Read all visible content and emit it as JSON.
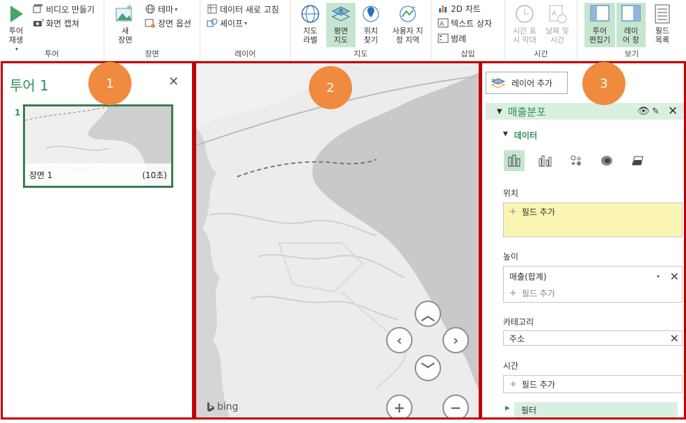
{
  "ribbon": {
    "tour": {
      "label": "투어",
      "play_label": "투어\n재생",
      "make_video": "비디오 만들기",
      "capture_screen": "화면 캡쳐"
    },
    "scene": {
      "label": "장면",
      "new_scene": "새\n장면",
      "theme": "테마",
      "scene_options": "장면 옵션"
    },
    "layer": {
      "label": "레이어",
      "refresh_data": "데이터 새로 고침",
      "shapes": "셰이프"
    },
    "map": {
      "label": "지도",
      "map_labels": "지도\n라벨",
      "flat_map": "평면\n지도",
      "find_location": "위치\n찾기",
      "custom_regions": "사용자 지\n정 지역"
    },
    "insert": {
      "label": "삽입",
      "chart_2d": "2D 차트",
      "text_box": "텍스트 상자",
      "legend": "범례"
    },
    "time": {
      "label": "시간",
      "timeline": "시간 표\n시 막대",
      "date_time": "날짜 및\n시간"
    },
    "view": {
      "label": "보기",
      "tour_editor": "투어\n편집기",
      "layer_pane": "레이\n어 창",
      "field_list": "필드\n목록"
    }
  },
  "tour_panel": {
    "title": "투어 1",
    "scene_number": "1",
    "scene_name": "장면 1",
    "scene_duration": "(10초)"
  },
  "map": {
    "logo": "bing"
  },
  "layer_panel": {
    "add_layer": "레이어 추가",
    "layer_name": "매출분포",
    "data_section": "데이터",
    "location_label": "위치",
    "location_placeholder": "필드 추가",
    "height_label": "높이",
    "height_field": "매출(합계)",
    "height_placeholder": "필드 추가",
    "category_label": "카테고리",
    "category_field": "주소",
    "time_label": "시간",
    "time_placeholder": "필드 추가",
    "filter_label": "필터"
  },
  "badges": [
    "1",
    "2",
    "3"
  ],
  "colors": {
    "accent_green": "#2f8f5b",
    "selected_bg": "#c6e5cf",
    "highlight_border": "#c00000",
    "badge": "#f08a3e",
    "location_drop_bg": "#fbf5b3"
  }
}
